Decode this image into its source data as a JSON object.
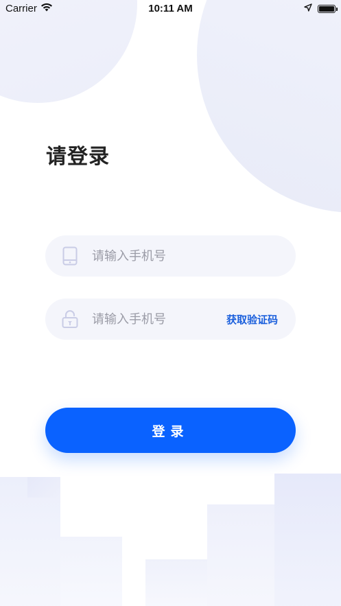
{
  "status_bar": {
    "carrier": "Carrier",
    "time": "10:11 AM",
    "wifi_icon": "wifi-icon",
    "location_icon": "location-arrow-icon",
    "battery_icon": "battery-full-icon"
  },
  "page": {
    "title": "请登录"
  },
  "phone_field": {
    "placeholder": "请输入手机号",
    "icon": "phone-icon"
  },
  "code_field": {
    "placeholder": "请输入手机号",
    "icon": "lock-icon",
    "get_code_label": "获取验证码"
  },
  "login_button": {
    "label": "登录"
  },
  "colors": {
    "accent": "#0a62ff",
    "link": "#1a5fdc",
    "field_bg": "#f4f5fb",
    "title": "#222222",
    "placeholder": "#9a9ba6"
  }
}
